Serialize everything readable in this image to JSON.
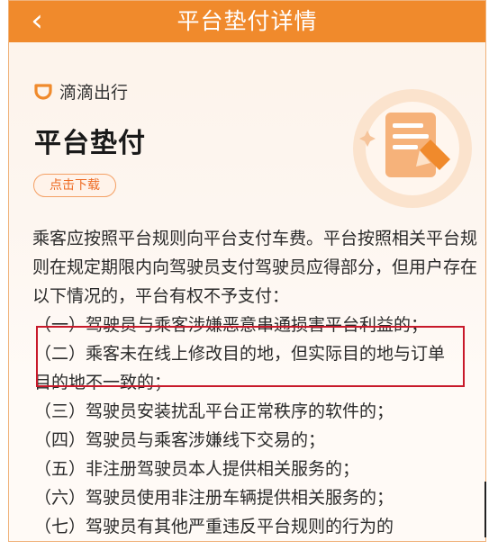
{
  "nav": {
    "back_icon": "chevron-left-icon",
    "title": "平台垫付详情"
  },
  "brand": {
    "logo_icon": "didi-logo-icon",
    "name": "滴滴出行"
  },
  "heading": "平台垫付",
  "download_button": "点击下载",
  "illustration_icon": "document-pencil-icon",
  "intro": "乘客应按照平台规则向平台支付车费。平台按照相关平台规则在规定期限内向驾驶员支付驾驶员应得部分，但用户存在以下情况的，平台有权不予支付：",
  "items": [
    "（一）驾驶员与乘客涉嫌恶意串通损害平台利益的；",
    "（二）乘客未在线上修改目的地，但实际目的地与订单目的地不一致的；",
    "（三）驾驶员安装扰乱平台正常秩序的软件的；",
    "（四）驾驶员与乘客涉嫌线下交易的；",
    "（五）非注册驾驶员本人提供相关服务的；",
    "（六）驾驶员使用非注册车辆提供相关服务的；",
    "（七）驾驶员有其他严重违反平台规则的行为的"
  ],
  "colors": {
    "accent": "#f08a2c",
    "highlight_box": "#c8192a",
    "button_text": "#ee6b24"
  }
}
